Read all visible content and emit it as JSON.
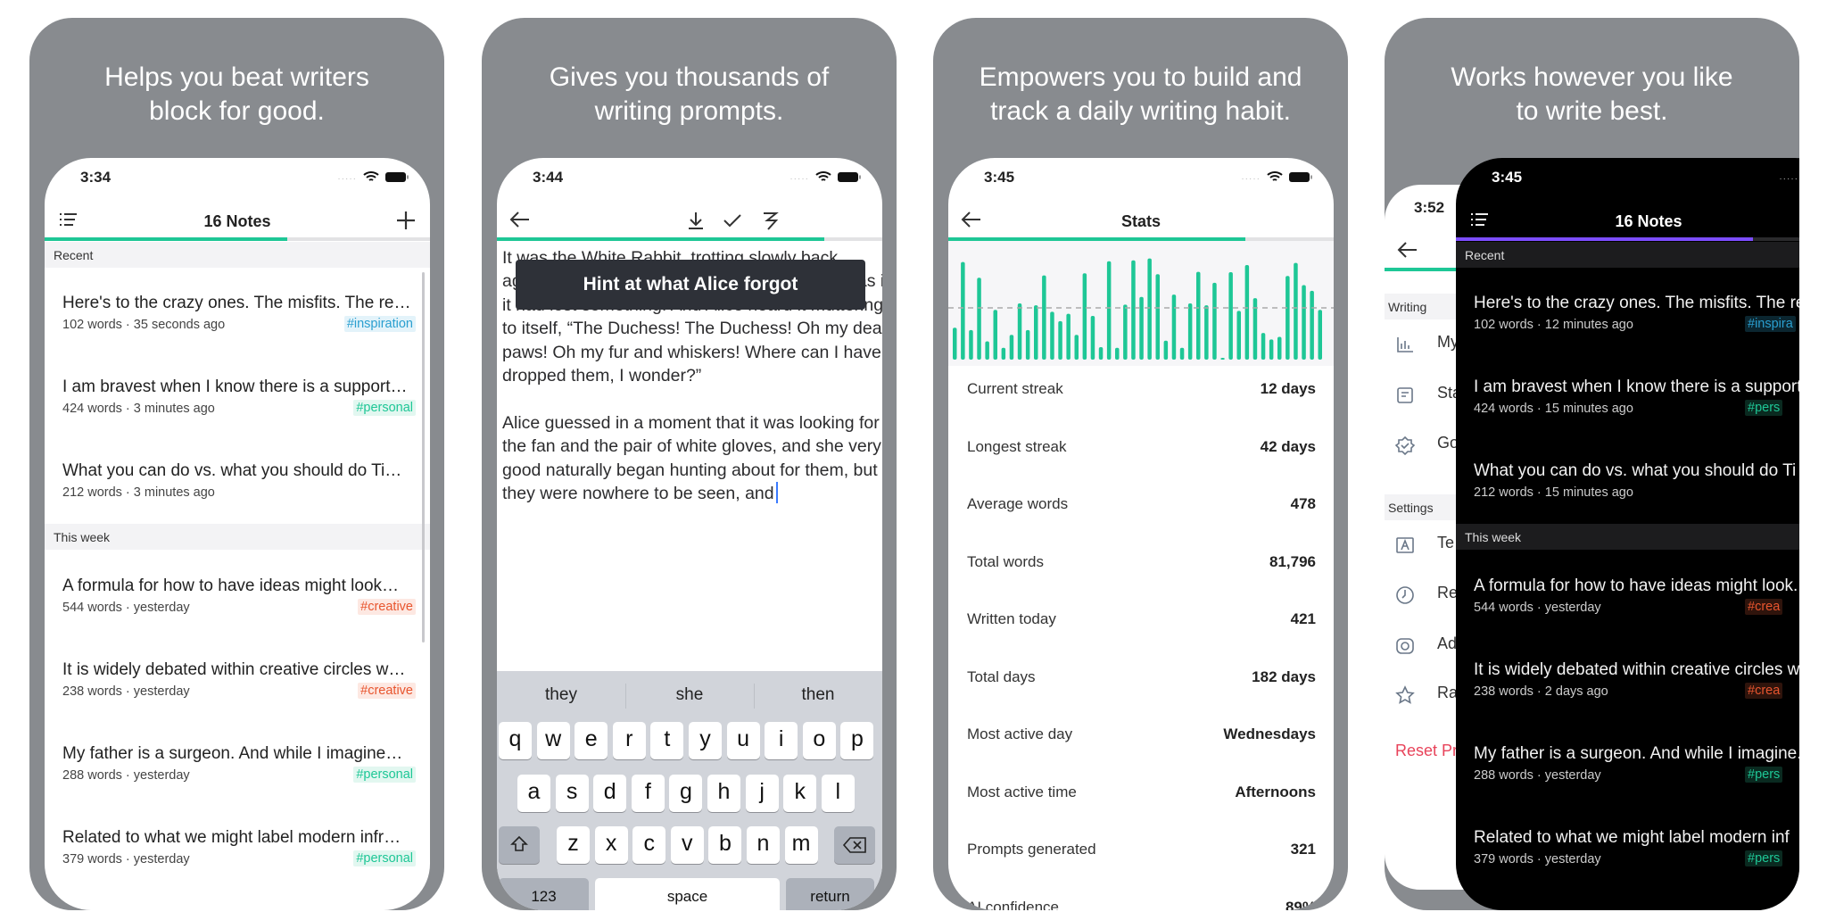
{
  "colors": {
    "accent_green": "#1ec796",
    "accent_purple": "#7c4dff",
    "reset_red": "#e8435a",
    "panel_gray": "#888b8f"
  },
  "panels": [
    {
      "headline_1": "Helps you beat writers",
      "headline_2": "block for good."
    },
    {
      "headline_1": "Gives you thousands of",
      "headline_2": "writing prompts."
    },
    {
      "headline_1": "Empowers you to build and",
      "headline_2": "track a daily writing habit."
    },
    {
      "headline_1": "Works however you like",
      "headline_2": "to write best."
    }
  ],
  "notes_screen": {
    "time": "3:34",
    "title": "16 Notes",
    "progress_percent": 63,
    "sections": {
      "recent": "Recent",
      "this_week": "This week"
    },
    "notes": [
      {
        "title": "Here's to the crazy ones. The misfits. The re…",
        "meta": "102 words · 35 seconds ago",
        "tag": "#inspiration",
        "tag_type": "inspiration"
      },
      {
        "title": "I am bravest when I know there is a support…",
        "meta": "424 words · 3 minutes ago",
        "tag": "#personal",
        "tag_type": "personal"
      },
      {
        "title": "What you can do vs. what you should do Ti…",
        "meta": "212 words · 3 minutes ago",
        "tag": "",
        "tag_type": ""
      },
      {
        "title": "A formula for how to have ideas might look…",
        "meta": "544 words · yesterday",
        "tag": "#creative",
        "tag_type": "creative"
      },
      {
        "title": "It is widely debated within creative circles w…",
        "meta": "238 words · yesterday",
        "tag": "#creative",
        "tag_type": "creative"
      },
      {
        "title": "My father is a surgeon. And while I imagine…",
        "meta": "288 words · yesterday",
        "tag": "#personal",
        "tag_type": "personal"
      },
      {
        "title": "Related to what we might label  modern  infr…",
        "meta": "379 words · yesterday",
        "tag": "#personal",
        "tag_type": "personal"
      }
    ]
  },
  "editor_screen": {
    "time": "3:44",
    "progress_percent": 85,
    "hint": "Hint at what Alice forgot",
    "lines": [
      "It was the White Rabbit, trotting slowly back",
      "again, and looking anxiously about as it went, as if",
      "it had lost something. And Alice heard it muttering",
      "to itself, “The Duchess! The Duchess! Oh my dear",
      "paws! Oh my fur and whiskers! Where can I have",
      "dropped them, I wonder?”",
      "",
      "Alice guessed in a moment that it was looking for",
      "the fan and the pair of white gloves, and she very",
      "good naturally began hunting about for them, but",
      "they were nowhere to be seen, and"
    ],
    "suggestions": [
      "they",
      "she",
      "then"
    ],
    "keys": {
      "row1": [
        "q",
        "w",
        "e",
        "r",
        "t",
        "y",
        "u",
        "i",
        "o",
        "p"
      ],
      "row2": [
        "a",
        "s",
        "d",
        "f",
        "g",
        "h",
        "j",
        "k",
        "l"
      ],
      "row3": [
        "z",
        "x",
        "c",
        "v",
        "b",
        "n",
        "m"
      ],
      "numbers": "123",
      "space": "space",
      "return": "return"
    }
  },
  "stats_screen": {
    "time": "3:45",
    "title": "Stats",
    "progress_percent": 77,
    "chart_data": {
      "type": "bar",
      "average_words": 478,
      "values": [
        295,
        901,
        273,
        756,
        169,
        459,
        109,
        229,
        519,
        273,
        502,
        778,
        442,
        355,
        423,
        229,
        797,
        404,
        115,
        909,
        109,
        508,
        917,
        579,
        934,
        789,
        175,
        601,
        109,
        519,
        811,
        502,
        710,
        14,
        808,
        450,
        874,
        568,
        246,
        186,
        210,
        773,
        893,
        688,
        636,
        459
      ]
    },
    "rows": [
      {
        "label": "Current streak",
        "value": "12 days"
      },
      {
        "label": "Longest streak",
        "value": "42 days"
      },
      {
        "label": "Average words",
        "value": "478"
      },
      {
        "label": "Total words",
        "value": "81,796"
      },
      {
        "label": "Written today",
        "value": "421"
      },
      {
        "label": "Total days",
        "value": "182 days"
      },
      {
        "label": "Most active day",
        "value": "Wednesdays"
      },
      {
        "label": "Most active time",
        "value": "Afternoons"
      },
      {
        "label": "Prompts generated",
        "value": "321"
      },
      {
        "label": "AI confidence",
        "value": "89%"
      }
    ]
  },
  "settings_screen": {
    "time": "3:52",
    "writing_section": "Writing",
    "settings_section": "Settings",
    "items": [
      {
        "label": "My",
        "icon": "bar-chart"
      },
      {
        "label": "Sta",
        "icon": "document"
      },
      {
        "label": "Go",
        "icon": "badge-check"
      },
      {
        "label": "Te",
        "icon": "text-a"
      },
      {
        "label": "Re",
        "icon": "clock"
      },
      {
        "label": "Ad",
        "icon": "gear-badge"
      },
      {
        "label": "Ra",
        "icon": "star"
      }
    ],
    "reset": "Reset Pr"
  },
  "dark_notes_screen": {
    "time": "3:45",
    "title": "16 Notes",
    "progress_percent": 77,
    "sections": {
      "recent": "Recent",
      "this_week": "This week"
    },
    "notes": [
      {
        "title": "Here's to the crazy ones. The misfits. The re",
        "meta": "102 words · 12 minutes ago",
        "tag": "#inspira",
        "tag_type": "inspiration"
      },
      {
        "title": "I am bravest when I know there is a support",
        "meta": "424 words · 15 minutes ago",
        "tag": "#pers",
        "tag_type": "personal"
      },
      {
        "title": "What you can do vs. what you should do Ti",
        "meta": "212 words · 15 minutes ago",
        "tag": "",
        "tag_type": ""
      },
      {
        "title": "A formula for how to have ideas might look.",
        "meta": "544 words · yesterday",
        "tag": "#crea",
        "tag_type": "creative"
      },
      {
        "title": "It is widely debated within creative circles w",
        "meta": "238 words · 2 days ago",
        "tag": "#crea",
        "tag_type": "creative"
      },
      {
        "title": "My father is a surgeon. And while I imagine.",
        "meta": "288 words · yesterday",
        "tag": "#pers",
        "tag_type": "personal"
      },
      {
        "title": "Related to what we might label  modern  inf",
        "meta": "379 words · yesterday",
        "tag": "#pers",
        "tag_type": "personal"
      }
    ]
  }
}
